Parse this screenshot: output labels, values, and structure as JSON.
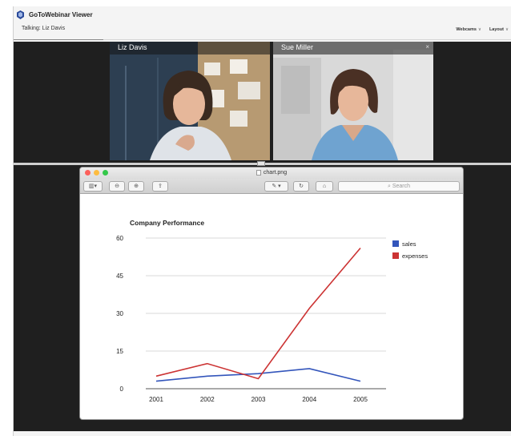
{
  "window": {
    "title": "GoToWebinar Viewer",
    "talking": "Talking: Liz Davis",
    "menus": [
      {
        "label": "Webcams",
        "icon": "chevron-down-icon"
      },
      {
        "label": "Layout",
        "icon": "chevron-down-icon"
      }
    ]
  },
  "webcams": [
    {
      "name": "Liz Davis"
    },
    {
      "name": "Sue Miller",
      "close": "×"
    }
  ],
  "preview": {
    "filename": "chart.png",
    "search_placeholder": "Search",
    "colors": {
      "close": "#fc605b",
      "minimize": "#fdbc40",
      "zoom": "#34c84a"
    }
  },
  "chart_data": {
    "type": "line",
    "title": "Company Performance",
    "x": [
      "2001",
      "2002",
      "2003",
      "2004",
      "2005"
    ],
    "ylim": [
      0,
      60
    ],
    "yticks": [
      0,
      15,
      30,
      45,
      60
    ],
    "grid": true,
    "legend_position": "right",
    "series": [
      {
        "name": "sales",
        "color": "#3355bb",
        "values": [
          3,
          5,
          6,
          8,
          3
        ]
      },
      {
        "name": "expenses",
        "color": "#cc3333",
        "values": [
          5,
          10,
          4,
          32,
          56
        ]
      }
    ]
  }
}
